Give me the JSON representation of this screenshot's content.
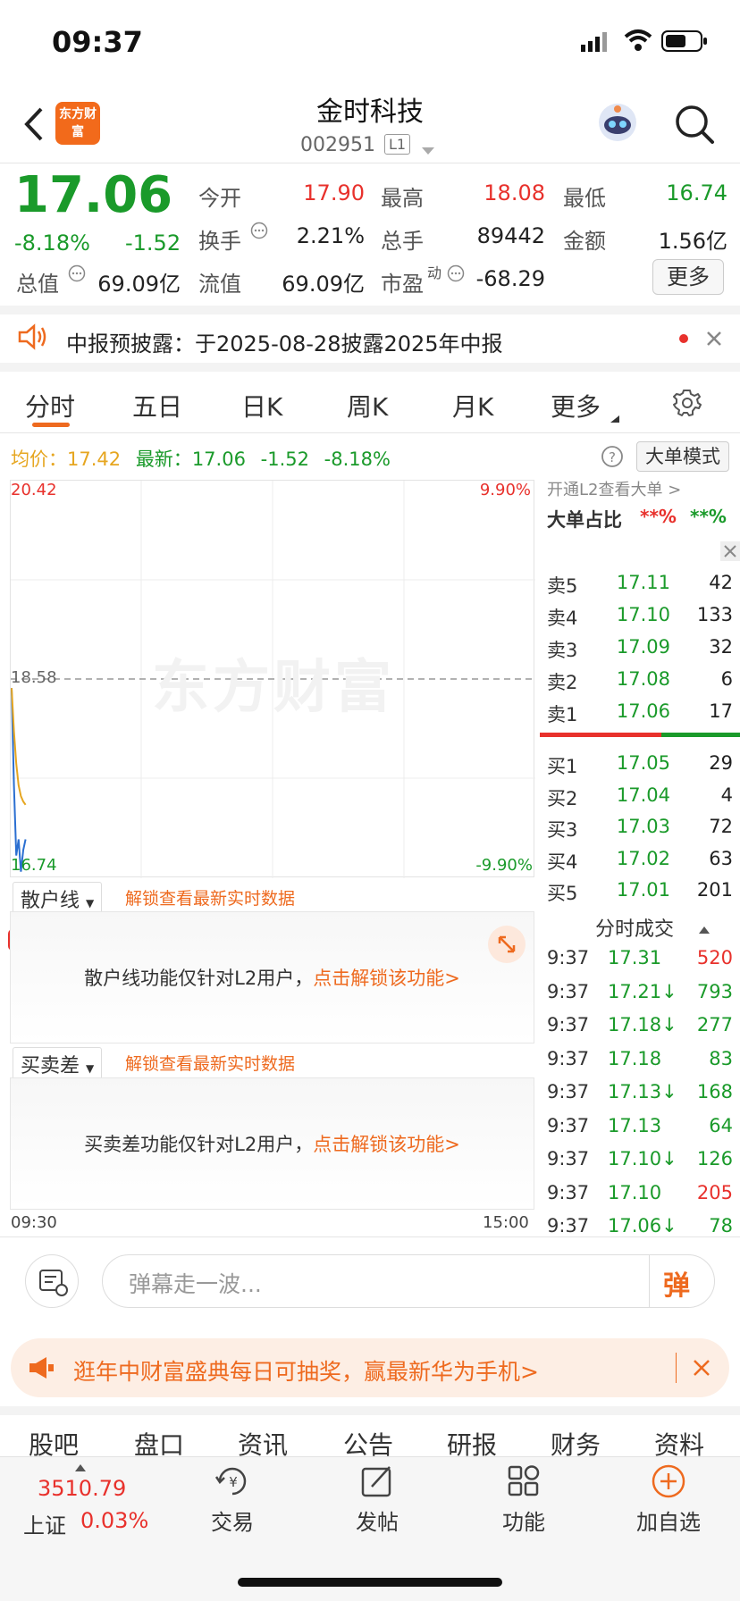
{
  "status_bar": {
    "time": "09:37"
  },
  "header": {
    "logo_text": "东方财富",
    "stock_name": "金时科技",
    "stock_code": "002951",
    "level_badge": "L1"
  },
  "quote": {
    "price": "17.06",
    "change_pct": "-8.18%",
    "change_amt": "-1.52",
    "open_label": "今开",
    "open": "17.90",
    "high_label": "最高",
    "high": "18.08",
    "low_label": "最低",
    "low": "16.74",
    "turnover_label": "换手",
    "turnover": "2.21%",
    "volume_label": "总手",
    "volume": "89442",
    "amount_label": "金额",
    "amount": "1.56亿",
    "mktcap_label": "总值",
    "mktcap": "69.09亿",
    "float_label": "流值",
    "float_cap": "69.09亿",
    "pe_label": "市盈",
    "pe_sup": "动",
    "pe": "-68.29",
    "more_button": "更多"
  },
  "notice": {
    "text": "中报预披露：于2025-08-28披露2025年中报"
  },
  "tabs": [
    "分时",
    "五日",
    "日K",
    "周K",
    "月K",
    "更多"
  ],
  "chart_header": {
    "avg_label": "均价：",
    "avg": "17.42",
    "latest_label": "最新：",
    "latest": "17.06",
    "latest_chg": "-1.52",
    "latest_pct": "-8.18%",
    "big_order_button": "大单模式"
  },
  "chart": {
    "y_top": "20.42",
    "y_mid": "18.58",
    "y_bottom": "16.74",
    "pct_top": "9.90%",
    "pct_bottom": "-9.90%",
    "x_start": "09:30",
    "x_end": "15:00",
    "watermark": "东方财富"
  },
  "chart_data": {
    "type": "line",
    "ylim": [
      16.74,
      20.42
    ],
    "series": [
      {
        "name": "最新",
        "values": [
          18.5,
          17.6,
          16.95,
          17.1,
          16.8,
          17.0,
          17.1
        ]
      },
      {
        "name": "均价",
        "values": [
          18.5,
          18.1,
          17.8,
          17.6,
          17.5,
          17.45,
          17.42
        ]
      }
    ]
  },
  "sub_panel_1": {
    "dropdown": "散户线",
    "unlock": "解锁查看最新实时数据",
    "message": "散户线功能仅针对L2用户，",
    "link": "点击解锁该功能>"
  },
  "sub_panel_2": {
    "dropdown": "买卖差",
    "unlock": "解锁查看最新实时数据",
    "message": "买卖差功能仅针对L2用户，",
    "link": "点击解锁该功能>"
  },
  "order_book": {
    "l2_hint": "开通L2查看大单 >",
    "big_ratio_label": "大单占比",
    "big_ratio_1": "**%",
    "big_ratio_2": "**%",
    "sells": [
      {
        "label": "卖5",
        "price": "17.11",
        "vol": "42"
      },
      {
        "label": "卖4",
        "price": "17.10",
        "vol": "133"
      },
      {
        "label": "卖3",
        "price": "17.09",
        "vol": "32"
      },
      {
        "label": "卖2",
        "price": "17.08",
        "vol": "6"
      },
      {
        "label": "卖1",
        "price": "17.06",
        "vol": "17"
      }
    ],
    "buys": [
      {
        "label": "买1",
        "price": "17.05",
        "vol": "29"
      },
      {
        "label": "买2",
        "price": "17.04",
        "vol": "4"
      },
      {
        "label": "买3",
        "price": "17.03",
        "vol": "72"
      },
      {
        "label": "买4",
        "price": "17.02",
        "vol": "63"
      },
      {
        "label": "买5",
        "price": "17.01",
        "vol": "201"
      }
    ],
    "trades_title": "分时成交",
    "trades": [
      {
        "time": "9:37",
        "price": "17.31",
        "vol": "520"
      },
      {
        "time": "9:37",
        "price": "17.21↓",
        "vol": "793"
      },
      {
        "time": "9:37",
        "price": "17.18↓",
        "vol": "277"
      },
      {
        "time": "9:37",
        "price": "17.18",
        "vol": "83"
      },
      {
        "time": "9:37",
        "price": "17.13↓",
        "vol": "168"
      },
      {
        "time": "9:37",
        "price": "17.13",
        "vol": "64"
      },
      {
        "time": "9:37",
        "price": "17.10↓",
        "vol": "126"
      },
      {
        "time": "9:37",
        "price": "17.10",
        "vol": "205"
      },
      {
        "time": "9:37",
        "price": "17.06↓",
        "vol": "78"
      }
    ]
  },
  "comment": {
    "placeholder": "弹幕走一波...",
    "send_label": "弹"
  },
  "banner": {
    "text": "逛年中财富盛典每日可抽奖，赢最新华为手机>"
  },
  "sub_tabs": [
    "股吧",
    "盘口",
    "资讯",
    "公告",
    "研报",
    "财务",
    "资料"
  ],
  "bottom_nav": {
    "index_value": "3510.79",
    "index_name": "上证",
    "index_pct": "0.03%",
    "items": [
      "交易",
      "发帖",
      "功能",
      "加自选"
    ]
  },
  "colors": {
    "up": "#e8312c",
    "down": "#1a9a2a",
    "accent": "#ee6a1f",
    "avg_line": "#e6a620",
    "price_line": "#2b6fd1"
  }
}
